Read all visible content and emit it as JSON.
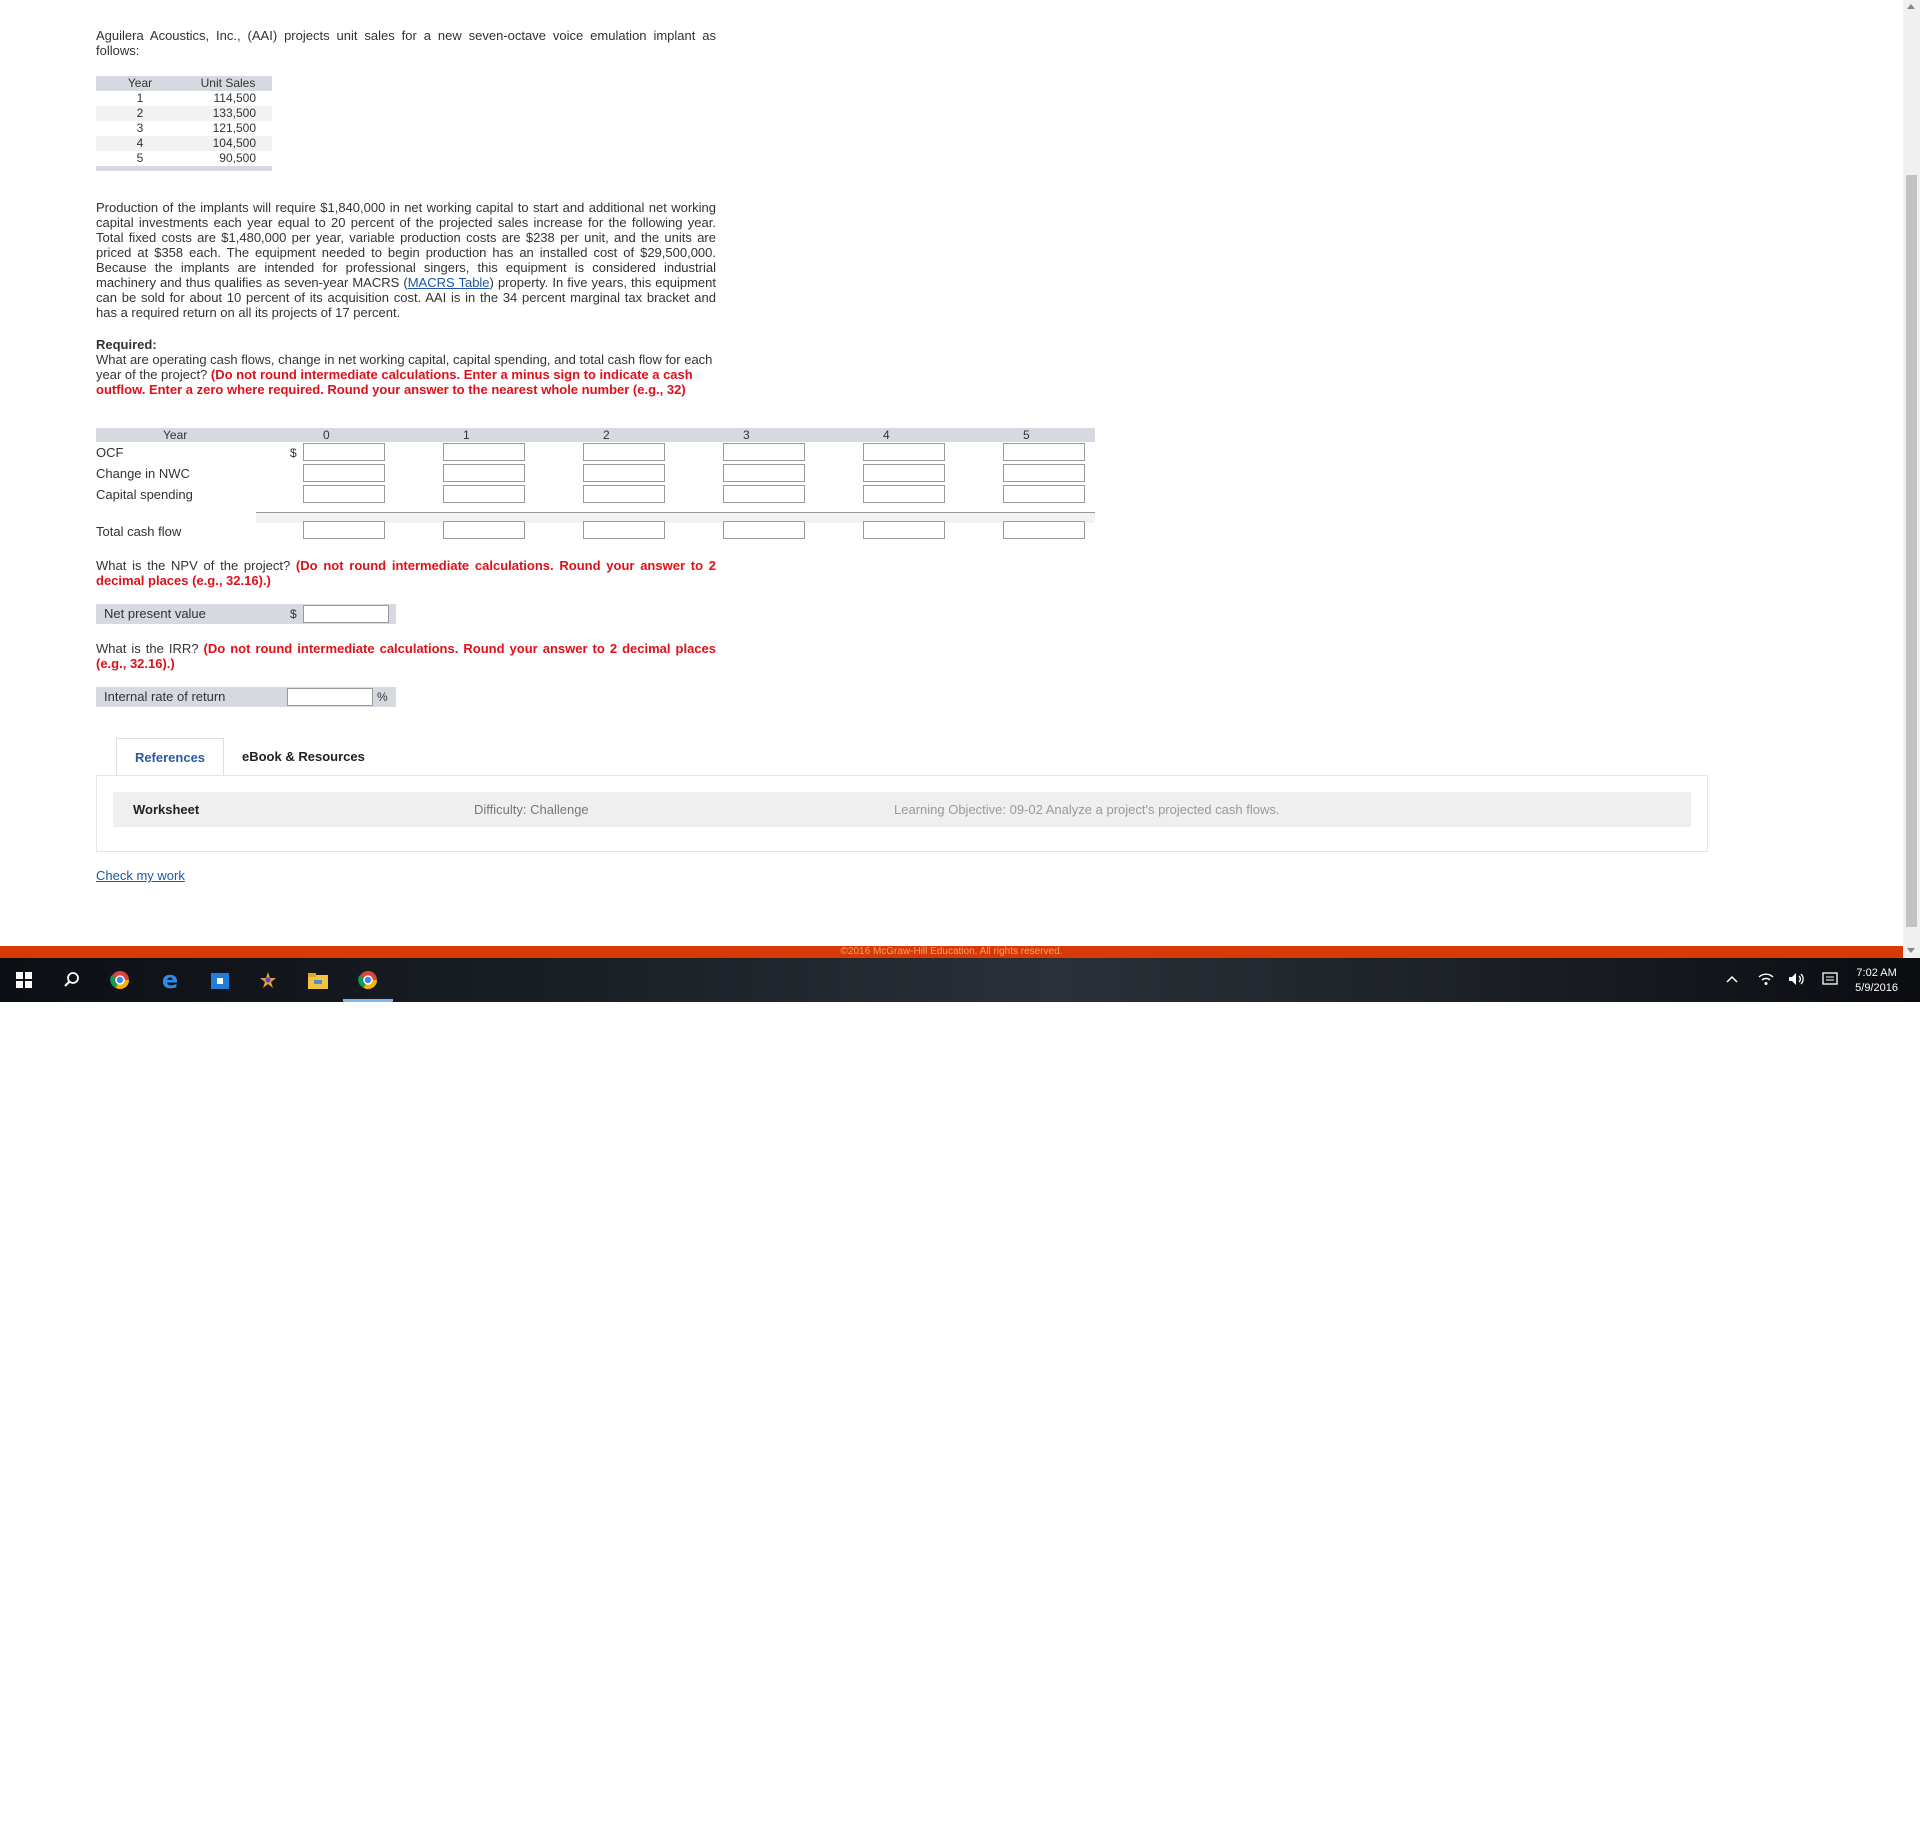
{
  "intro": "Aguilera Acoustics, Inc., (AAI) projects unit sales for a new seven-octave voice emulation implant as follows:",
  "sales_table": {
    "headers": [
      "Year",
      "Unit Sales"
    ],
    "rows": [
      [
        "1",
        "114,500"
      ],
      [
        "2",
        "133,500"
      ],
      [
        "3",
        "121,500"
      ],
      [
        "4",
        "104,500"
      ],
      [
        "5",
        "90,500"
      ]
    ]
  },
  "paragraph": {
    "before_link": "Production of the implants will require $1,840,000 in net working capital to start and additional net working capital investments each year equal to 20 percent of the projected sales increase for the following year. Total fixed costs are $1,480,000 per year, variable production costs are $238 per unit, and the units are priced at $358 each. The equipment needed to begin production has an installed cost of $29,500,000. Because the implants are intended for professional singers, this equipment is considered industrial machinery and thus qualifies as seven-year MACRS (",
    "link": "MACRS Table",
    "after_link": ") property. In five years, this equipment can be sold for about 10 percent of its acquisition cost. AAI is in the 34 percent marginal tax bracket and has a required return on all its projects of 17 percent."
  },
  "required": {
    "heading": "Required:",
    "question": "What are operating cash flows, change in net working capital, capital spending, and total cash flow for each year of the project? ",
    "instruction": "(Do not round intermediate calculations. Enter a minus sign to indicate a cash outflow. Enter a zero where required. Round your answer to the nearest whole number (e.g., 32)"
  },
  "cashflow": {
    "year_label": "Year",
    "years": [
      "0",
      "1",
      "2",
      "3",
      "4",
      "5"
    ],
    "rows": [
      "OCF",
      "Change in NWC",
      "Capital spending"
    ],
    "total_label": "Total cash flow",
    "currency": "$"
  },
  "npv": {
    "question": "What is the NPV of the project? ",
    "instruction": "(Do not round intermediate calculations. Round your answer to 2 decimal places (e.g., 32.16).)",
    "label": "Net present value",
    "currency": "$"
  },
  "irr": {
    "question": "What is the IRR? ",
    "instruction": "(Do not round intermediate calculations. Round your answer to 2 decimal places (e.g., 32.16).)",
    "label": "Internal rate of return",
    "unit": "%"
  },
  "tabs": {
    "references": "References",
    "ebook": "eBook & Resources"
  },
  "panel": {
    "worksheet": "Worksheet",
    "difficulty": "Difficulty: Challenge",
    "objective": "Learning Objective: 09-02 Analyze a project's projected cash flows."
  },
  "check_link": "Check my work",
  "footer": "©2016 McGraw-Hill Education. All rights reserved.",
  "taskbar": {
    "time": "7:02 AM",
    "date": "5/9/2016"
  },
  "colors": {
    "accent_red": "#e0101a",
    "footer_orange": "#d73a06",
    "link_blue": "#1a57a8",
    "header_gray": "#d7d9e0"
  }
}
